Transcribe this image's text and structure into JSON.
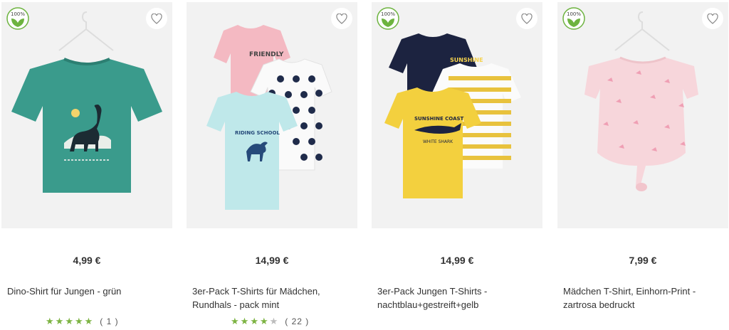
{
  "products": [
    {
      "price": "4,99 €",
      "name": "Dino-Shirt für Jungen - grün",
      "badge": "100%",
      "rating": {
        "stars": 5,
        "count": "( 1 )"
      }
    },
    {
      "price": "14,99 €",
      "name": "3er-Pack T-Shirts für Mädchen, Rundhals - pack mint",
      "badge": "",
      "rating": {
        "stars": 4.5,
        "count": "( 22 )"
      }
    },
    {
      "price": "14,99 €",
      "name": "3er-Pack Jungen T-Shirts - nachtblau+gestreift+gelb",
      "badge": "100%",
      "rating": null
    },
    {
      "price": "7,99 €",
      "name": "Mädchen T-Shirt, Einhorn-Print - zartrosa bedruckt",
      "badge": "100%",
      "rating": null
    }
  ],
  "colors": {
    "star": "#7cb342",
    "badge_green": "#6db33f"
  },
  "icons": {
    "favorite": "heart-outline-icon",
    "badge": "organic-leaf-badge-icon"
  }
}
